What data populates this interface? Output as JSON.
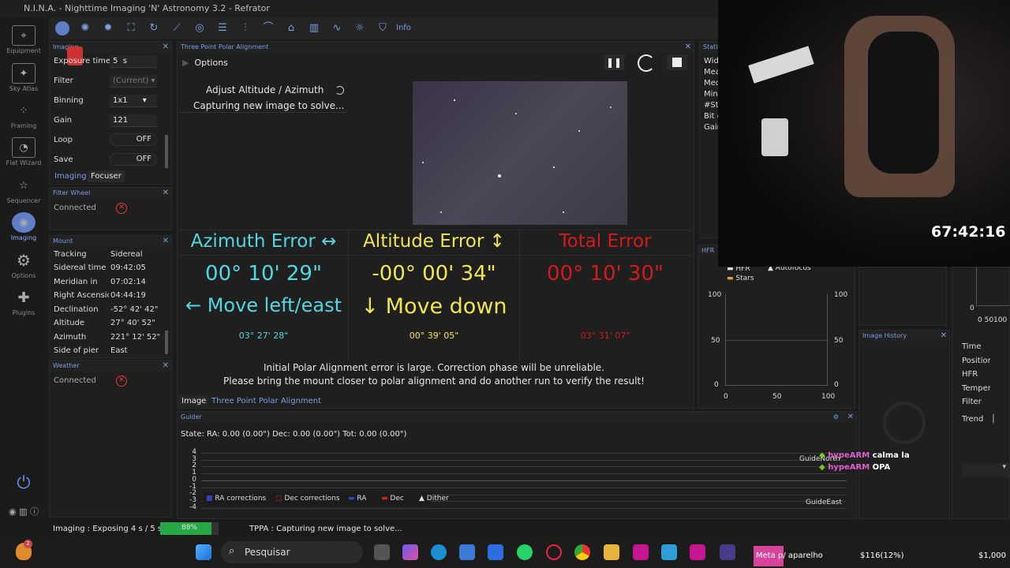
{
  "window": {
    "title": "N.I.N.A. - Nighttime Imaging 'N' Astronomy 3.2 - Refrator"
  },
  "nav": {
    "equipment": "Equipment",
    "sky_atlas": "Sky Atlas",
    "framing": "Framing",
    "flat_wizard": "Flat Wizard",
    "sequencer": "Sequencer",
    "imaging": "Imaging",
    "options": "Options",
    "plugins": "Plugins"
  },
  "toolbar": {
    "info": "Info"
  },
  "imaging_panel": {
    "title": "Imaging",
    "exposure_label": "Exposure time",
    "exposure_value": "5",
    "exposure_unit": "s",
    "filter_label": "Filter",
    "filter_value": "(Current)",
    "binning_label": "Binning",
    "binning_value": "1x1",
    "gain_label": "Gain",
    "gain_value": "121",
    "loop_label": "Loop",
    "loop_value": "OFF",
    "save_label": "Save",
    "save_value": "OFF",
    "tab_imaging": "Imaging",
    "tab_focuser": "Focuser"
  },
  "filter_wheel": {
    "title": "Filter Wheel",
    "status": "Connected"
  },
  "mount": {
    "title": "Mount",
    "rows": [
      {
        "k": "Tracking",
        "v": "Sidereal"
      },
      {
        "k": "Sidereal time",
        "v": "09:42:05"
      },
      {
        "k": "Meridian in",
        "v": "07:02:14"
      },
      {
        "k": "Right Ascension",
        "v": "04:44:19"
      },
      {
        "k": "Declination",
        "v": "-52° 42' 42\""
      },
      {
        "k": "Altitude",
        "v": "27° 40' 52\""
      },
      {
        "k": "Azimuth",
        "v": "221° 12' 52\""
      },
      {
        "k": "Side of pier",
        "v": "East"
      }
    ]
  },
  "weather": {
    "title": "Weather",
    "status": "Connected"
  },
  "tppa": {
    "title": "Three Point Polar Alignment",
    "options": "Options",
    "step": "Adjust Altitude / Azimuth",
    "status": "Capturing new image to solve...",
    "azimuth": {
      "heading": "Azimuth Error ↔",
      "value": "00° 10' 29\"",
      "move": "← Move left/east",
      "sub": "03° 27' 28\""
    },
    "altitude": {
      "heading": "Altitude Error ↕",
      "value": "-00° 00' 34\"",
      "move": "↓ Move down",
      "sub": "00° 39' 05\""
    },
    "total": {
      "heading": "Total Error",
      "value": "00° 10' 30\"",
      "sub": "03° 31' 07\""
    },
    "warning1": "Initial Polar Alignment error is large. Correction phase will be unreliable.",
    "warning2": "Please bring the mount closer to polar alignment and do another run to verify the result!",
    "tab_image": "Image",
    "tab_tppa": "Three Point Polar Alignment"
  },
  "statistics": {
    "title": "Statistics",
    "labels": [
      "Wid",
      "Mea",
      "Med",
      "Min",
      "#Sta",
      "Bit d",
      "Gain"
    ]
  },
  "hfr": {
    "title": "HFR History",
    "legend": [
      "HFR",
      "Autofocus",
      "Stars"
    ],
    "y_left": [
      "100",
      "50",
      "0"
    ],
    "y_right": [
      "100",
      "50",
      "0"
    ],
    "x": [
      "0",
      "50",
      "100"
    ]
  },
  "image_history": {
    "title": "Image History"
  },
  "right_panel": {
    "y0": "0",
    "x": "0 50100",
    "labels": [
      "Time",
      "Position",
      "HFR",
      "Temperature",
      "Filter"
    ],
    "trend": "Trend"
  },
  "guider": {
    "title": "Guider",
    "state": "State:  RA: 0.00 (0.00\")  Dec: 0.00 (0.00\")  Tot: 0.00 (0.00\")",
    "y_ticks": [
      "4",
      "3",
      "2",
      "1",
      "0",
      "-1",
      "-2",
      "-3",
      "-4"
    ],
    "legend": [
      "RA corrections",
      "Dec corrections",
      "RA",
      "Dec",
      "Dither"
    ],
    "guide_north": "GuideNorth",
    "guide_east": "GuideEast"
  },
  "chat": [
    {
      "user": "hypeARM",
      "msg": "calma la"
    },
    {
      "user": "hypeARM",
      "msg": "OPA"
    }
  ],
  "stream": {
    "timer": "67:42:16"
  },
  "statusbar": {
    "imaging": "Imaging :  Exposing 4 s / 5 s",
    "progress_label": "88%",
    "progress": 0.88,
    "tppa": "TPPA :  Capturing new image to solve..."
  },
  "taskbar": {
    "search": "Pesquisar",
    "notif": "2",
    "meta": "Meta p/ aparelho",
    "money1": "$116(12%)",
    "money2": "$1,000"
  }
}
